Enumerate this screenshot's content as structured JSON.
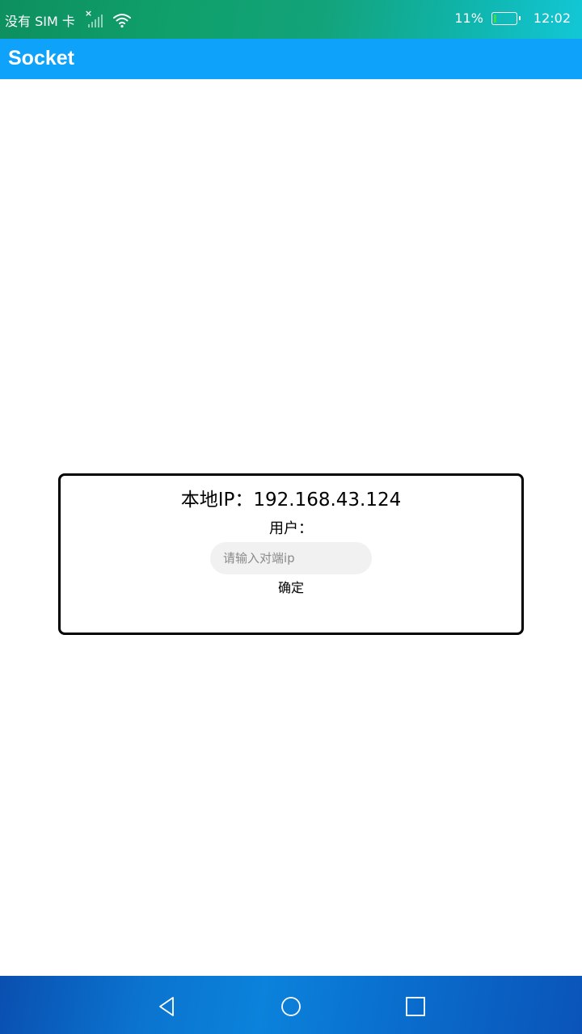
{
  "status_bar": {
    "carrier": "没有 SIM 卡",
    "no_signal_mark": "×",
    "battery_percent": "11%",
    "battery_level": 0.11,
    "time": "12:02",
    "icons": [
      "signal-icon",
      "wifi-icon",
      "battery-icon"
    ]
  },
  "app_bar": {
    "title": "Socket",
    "color": "#0ea2fb"
  },
  "card": {
    "local_ip_label": "本地IP：192.168.43.124",
    "user_label": "用户：",
    "input": {
      "placeholder": "请输入对端ip",
      "value": ""
    },
    "confirm_label": "确定"
  },
  "nav_bar": {
    "icons": [
      "back-icon",
      "home-icon",
      "recents-icon"
    ]
  }
}
